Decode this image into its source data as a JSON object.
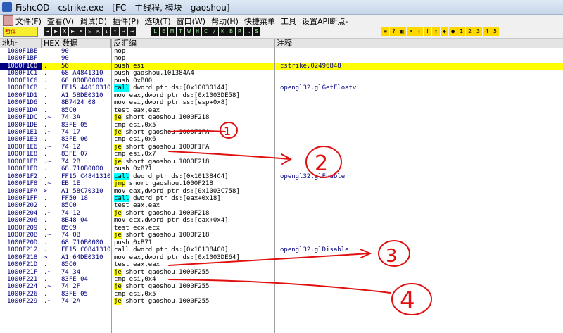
{
  "window": {
    "title": "FishcOD - cstrike.exe - [FC - 主线程, 模块 - gaoshou]"
  },
  "menu": {
    "items": [
      "文件(F)",
      "查看(V)",
      "调试(D)",
      "插件(P)",
      "选项(T)",
      "窗口(W)",
      "帮助(H)",
      "快捷菜单",
      "工具",
      "设置API断点-"
    ]
  },
  "toolbar": {
    "status": "暂停",
    "buttons1": [
      "◄",
      "▶",
      "X",
      "▶",
      "⏸",
      "⇲",
      "⇱",
      "↓",
      "↑",
      "→",
      "⇥"
    ],
    "buttons2": [
      "L",
      "E",
      "M",
      "T",
      "W",
      "H",
      "C",
      "/",
      "K",
      "B",
      "R",
      "...",
      "S"
    ],
    "buttons3": [
      "≡",
      "?",
      "◧",
      "⏸",
      "⇩",
      "!",
      "⇧",
      "◆",
      "●",
      "1",
      "2",
      "3",
      "4",
      "5"
    ]
  },
  "columns": {
    "address": "地址",
    "hex": "HEX 数据",
    "disasm": "反汇编",
    "comment": "注释"
  },
  "rows": [
    {
      "addr": "1000F1BE",
      "arrow": "",
      "hex": "90",
      "op": "",
      "rest": "nop",
      "hl": "",
      "comment": ""
    },
    {
      "addr": "1000F1BF",
      "arrow": "",
      "hex": "90",
      "op": "",
      "rest": "nop",
      "hl": "",
      "comment": ""
    },
    {
      "addr": "1000F1C0",
      "arrow": ".",
      "hex": "56",
      "op": "",
      "rest": "push esi",
      "hl": "",
      "comment": "cstrike.02496848",
      "selected": true
    },
    {
      "addr": "1000F1C1",
      "arrow": ".",
      "hex": "68 A4841310",
      "op": "",
      "rest": "push gaoshou.101384A4",
      "hl": "",
      "comment": ""
    },
    {
      "addr": "1000F1C6",
      "arrow": ".",
      "hex": "68 000B0000",
      "op": "",
      "rest": "push 0xB00",
      "hl": "",
      "comment": ""
    },
    {
      "addr": "1000F1CB",
      "arrow": ".",
      "hex": "FF15 44010310",
      "op": "call",
      "rest": " dword ptr ds:[0x10030144]",
      "hl": "call",
      "comment": "opengl32.glGetFloatv"
    },
    {
      "addr": "1000F1D1",
      "arrow": ".",
      "hex": "A1 58DE0310",
      "op": "",
      "rest": "mov eax,dword ptr ds:[0x1003DE58]",
      "hl": "",
      "comment": ""
    },
    {
      "addr": "1000F1D6",
      "arrow": ".",
      "hex": "8B7424 08",
      "op": "",
      "rest": "mov esi,dword ptr ss:[esp+0x8]",
      "hl": "",
      "comment": ""
    },
    {
      "addr": "1000F1DA",
      "arrow": ".",
      "hex": "85C0",
      "op": "",
      "rest": "test eax,eax",
      "hl": "",
      "comment": ""
    },
    {
      "addr": "1000F1DC",
      "arrow": ".~",
      "hex": "74 3A",
      "op": "je",
      "rest": " short gaoshou.1000F218",
      "hl": "je",
      "comment": ""
    },
    {
      "addr": "1000F1DE",
      "arrow": ".",
      "hex": "83FE 05",
      "op": "",
      "rest": "cmp esi,0x5",
      "hl": "",
      "comment": ""
    },
    {
      "addr": "1000F1E1",
      "arrow": ".~",
      "hex": "74 17",
      "op": "je",
      "rest": " short gaoshou.1000F1FA",
      "hl": "je",
      "comment": ""
    },
    {
      "addr": "1000F1E3",
      "arrow": ".",
      "hex": "83FE 06",
      "op": "",
      "rest": "cmp esi,0x6",
      "hl": "",
      "comment": ""
    },
    {
      "addr": "1000F1E6",
      "arrow": ".~",
      "hex": "74 12",
      "op": "je",
      "rest": " short gaoshou.1000F1FA",
      "hl": "je",
      "comment": ""
    },
    {
      "addr": "1000F1E8",
      "arrow": ".",
      "hex": "83FE 07",
      "op": "",
      "rest": "cmp esi,0x7",
      "hl": "",
      "comment": ""
    },
    {
      "addr": "1000F1EB",
      "arrow": ".~",
      "hex": "74 2B",
      "op": "je",
      "rest": " short gaoshou.1000F218",
      "hl": "je",
      "comment": ""
    },
    {
      "addr": "1000F1ED",
      "arrow": ".",
      "hex": "68 710B0000",
      "op": "",
      "rest": "push 0xB71",
      "hl": "",
      "comment": ""
    },
    {
      "addr": "1000F1F2",
      "arrow": ".",
      "hex": "FF15 C4841310",
      "op": "call",
      "rest": " dword ptr ds:[0x101384C4]",
      "hl": "call",
      "comment": "opengl32.glEnable"
    },
    {
      "addr": "1000F1F8",
      "arrow": ".~",
      "hex": "EB 1E",
      "op": "jmp",
      "rest": " short gaoshou.1000F218",
      "hl": "jmp",
      "comment": ""
    },
    {
      "addr": "1000F1FA",
      "arrow": ">",
      "hex": "A1 58C70310",
      "op": "",
      "rest": "mov eax,dword ptr ds:[0x1003C758]",
      "hl": "",
      "comment": ""
    },
    {
      "addr": "1000F1FF",
      "arrow": ".",
      "hex": "FF50 18",
      "op": "call",
      "rest": " dword ptr ds:[eax+0x18]",
      "hl": "call",
      "comment": ""
    },
    {
      "addr": "1000F202",
      "arrow": ".",
      "hex": "85C0",
      "op": "",
      "rest": "test eax,eax",
      "hl": "",
      "comment": ""
    },
    {
      "addr": "1000F204",
      "arrow": ".~",
      "hex": "74 12",
      "op": "je",
      "rest": " short gaoshou.1000F218",
      "hl": "je",
      "comment": ""
    },
    {
      "addr": "1000F206",
      "arrow": ".",
      "hex": "8B48 04",
      "op": "",
      "rest": "mov ecx,dword ptr ds:[eax+0x4]",
      "hl": "",
      "comment": ""
    },
    {
      "addr": "1000F209",
      "arrow": ".",
      "hex": "85C9",
      "op": "",
      "rest": "test ecx,ecx",
      "hl": "",
      "comment": ""
    },
    {
      "addr": "1000F20B",
      "arrow": ".~",
      "hex": "74 0B",
      "op": "je",
      "rest": " short gaoshou.1000F218",
      "hl": "je",
      "comment": ""
    },
    {
      "addr": "1000F20D",
      "arrow": ".",
      "hex": "68 710B0000",
      "op": "",
      "rest": "push 0xB71",
      "hl": "",
      "comment": ""
    },
    {
      "addr": "1000F212",
      "arrow": ".",
      "hex": "FF15 C0841310",
      "op": "",
      "rest": "call dword ptr ds:[0x101384C0]",
      "hl": "",
      "comment": "opengl32.glDisable"
    },
    {
      "addr": "1000F218",
      "arrow": ">",
      "hex": "A1 64DE0310",
      "op": "",
      "rest": "mov eax,dword ptr ds:[0x1003DE64]",
      "hl": "",
      "comment": ""
    },
    {
      "addr": "1000F21D",
      "arrow": ".",
      "hex": "85C0",
      "op": "",
      "rest": "test eax,eax",
      "hl": "",
      "comment": ""
    },
    {
      "addr": "1000F21F",
      "arrow": ".~",
      "hex": "74 34",
      "op": "je",
      "rest": " short gaoshou.1000F255",
      "hl": "je",
      "comment": ""
    },
    {
      "addr": "1000F221",
      "arrow": ".",
      "hex": "83FE 04",
      "op": "",
      "rest": "cmp esi,0x4",
      "hl": "",
      "comment": ""
    },
    {
      "addr": "1000F224",
      "arrow": ".~",
      "hex": "74 2F",
      "op": "je",
      "rest": " short gaoshou.1000F255",
      "hl": "je",
      "comment": ""
    },
    {
      "addr": "1000F226",
      "arrow": ".",
      "hex": "83FE 05",
      "op": "",
      "rest": "cmp esi,0x5",
      "hl": "",
      "comment": ""
    },
    {
      "addr": "1000F229",
      "arrow": ".~",
      "hex": "74 2A",
      "op": "je",
      "rest": " short gaoshou.1000F255",
      "hl": "je",
      "comment": ""
    }
  ],
  "annotations": {
    "labels": [
      "1",
      "2",
      "3",
      "4"
    ],
    "color": "#e01010"
  }
}
